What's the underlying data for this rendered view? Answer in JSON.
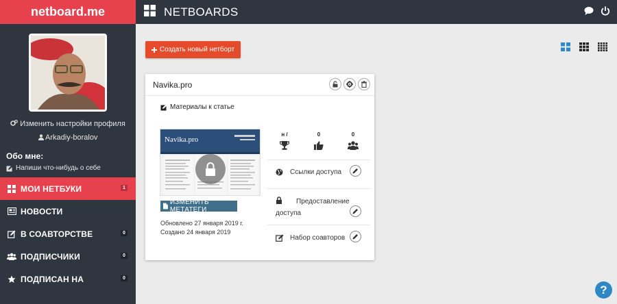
{
  "sidebar": {
    "brand": "netboard.me",
    "profile_settings": "Изменить настройки профиля",
    "username": "Arkadiy-boralov",
    "about_title": "Обо мне:",
    "about_text": "Напиши что-нибудь о себе",
    "nav": [
      {
        "label": "МОИ НЕТБУКИ",
        "badge": "1",
        "active": true
      },
      {
        "label": "НОВОСТИ",
        "badge": ""
      },
      {
        "label": "В СОАВТОРСТВЕ",
        "badge": "0"
      },
      {
        "label": "ПОДПИСЧИКИ",
        "badge": "0"
      },
      {
        "label": "ПОДПИСАН НА",
        "badge": "0"
      }
    ]
  },
  "header": {
    "title": "NETBOARDS"
  },
  "main": {
    "create_button": "Создать новый нетборт",
    "card": {
      "title": "Navika.pro",
      "description": "Материалы к статье",
      "thumbnail_title": "Navika.pro",
      "meta_button": "ИЗМЕНИТЬ МЕТАТЕГИ",
      "updated": "Обновлено 27 января 2019 г.",
      "created": "Создано 24 января 2019",
      "stats": [
        {
          "value": "н /",
          "icon": "trophy-icon"
        },
        {
          "value": "0",
          "icon": "thumbs-up-icon"
        },
        {
          "value": "0",
          "icon": "users-icon"
        }
      ],
      "access_links": "Ссылки доступа",
      "access_grant": "Предоставление доступа",
      "coauthors": "Набор соавторов"
    }
  },
  "help_label": "?",
  "colors": {
    "accent": "#e8414e",
    "sidebar": "#2f3640",
    "create_button": "#e34b2a",
    "toggle_active": "#2e88c5",
    "meta_button": "#3f6f8a"
  }
}
